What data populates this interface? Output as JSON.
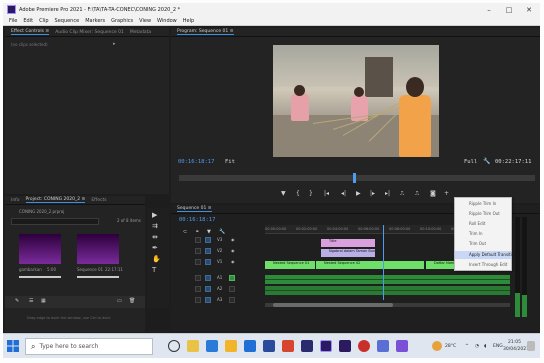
{
  "window": {
    "title": "Adobe Premiere Pro 2021 - F:\\TA\\TA-TA-CONEC\\CONING 2020_2 *",
    "minimize_glyph": "–",
    "maximize_glyph": "□",
    "close_glyph": "✕"
  },
  "menu": [
    "File",
    "Edit",
    "Clip",
    "Sequence",
    "Markers",
    "Graphics",
    "View",
    "Window",
    "Help"
  ],
  "source_panel": {
    "tabs": [
      "Effect Controls ≡",
      "Audio Clip Mixer: Sequence 01",
      "Metadata"
    ],
    "no_clip_text": "(no clips selected)"
  },
  "program_monitor": {
    "tab": "Program: Sequence 01 ≡",
    "timecode_current": "00:16:18:17",
    "fit_label": "Fit",
    "full_label": "Full",
    "timecode_duration": "00:22:17:11"
  },
  "project_panel": {
    "tabs": [
      "Info",
      "Project: CONING 2020_2 ≡",
      "Effects"
    ],
    "project_file": "CONING 2020_2.prproj",
    "item_count": "2 of 8 items",
    "items": [
      {
        "name": "gambarkan",
        "duration": "5:00"
      },
      {
        "name": "Sequence 01",
        "duration": "22:17:11"
      }
    ],
    "status_hint": "Drag edge to dock the window, use Ctrl to dock"
  },
  "timeline": {
    "tab": "Sequence 01 ≡",
    "timecode": "00:16:18:17",
    "ruler_labels": [
      "00:00:00:00",
      "00:02:00:00",
      "00:04:00:00",
      "00:06:00:00",
      "00:08:00:00",
      "00:10:00:00",
      "00:12:00:00",
      "00:14:00:00"
    ],
    "tracks": [
      "V3",
      "V2",
      "V1",
      "A1",
      "A2",
      "A3"
    ],
    "clips": [
      {
        "label": "Title",
        "color": "#d9a0dd"
      },
      {
        "label": "Ngobrol dalam Taman Bunga",
        "color": "#b9aee6"
      },
      {
        "label": "Nested Sequence 01",
        "color": "#6ee06a"
      },
      {
        "label": "Nested Sequence 02",
        "color": "#6ee06a"
      },
      {
        "label": "Daftar Nama",
        "color": "#6ee06a"
      }
    ]
  },
  "context_menu": {
    "items": [
      "Ripple Trim In",
      "Ripple Trim Out",
      "Roll Edit",
      "Trim In",
      "Trim Out",
      "Apply Default Transitions",
      "Insert Through Edit"
    ],
    "highlighted_index": 5
  },
  "taskbar": {
    "search_placeholder": "Type here to search",
    "weather": "28°C",
    "time": "21:05",
    "date": "30/04/2021",
    "lang": "ENG"
  },
  "colors": {
    "accent": "#4e9cf0",
    "video_clip": "#6ee06a",
    "audio_clip": "#2e8b3a",
    "title_clip": "#d9a0dd"
  }
}
